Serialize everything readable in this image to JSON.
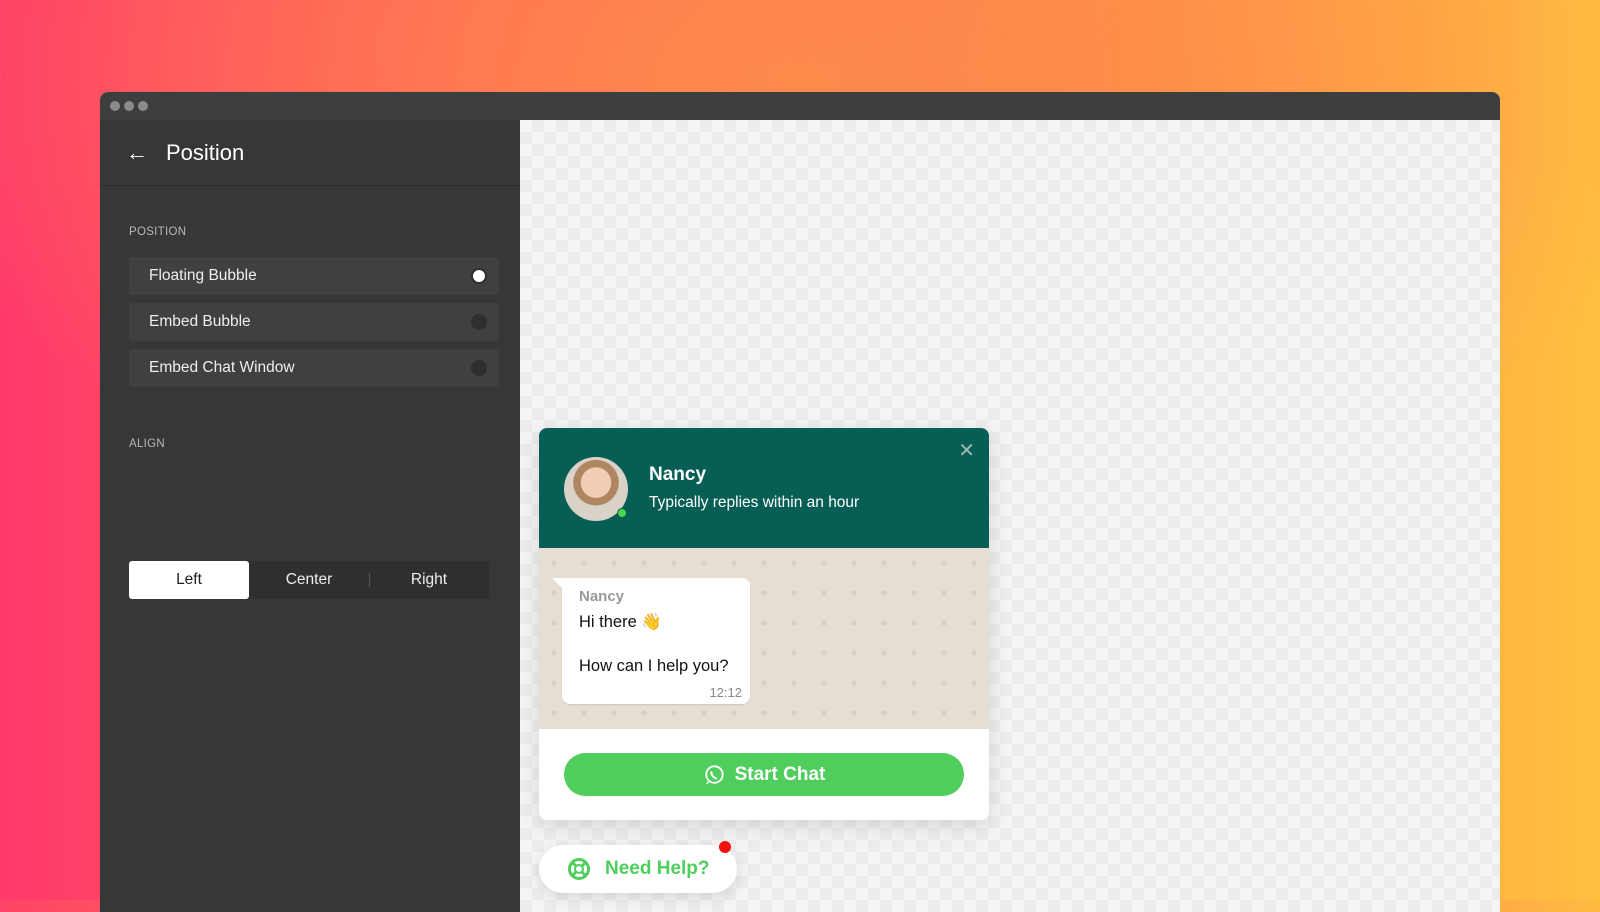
{
  "sidebar": {
    "title": "Position",
    "position_label": "POSITION",
    "options": [
      {
        "label": "Floating Bubble",
        "selected": true
      },
      {
        "label": "Embed Bubble",
        "selected": false
      },
      {
        "label": "Embed Chat Window",
        "selected": false
      }
    ],
    "align_label": "ALIGN",
    "align_options": [
      "Left",
      "Center",
      "Right"
    ],
    "align_selected": "Left"
  },
  "chat": {
    "agent_name": "Nancy",
    "status": "Typically replies within an hour",
    "message": {
      "sender": "Nancy",
      "text": "Hi there 👋\n\nHow can I help you?",
      "time": "12:12"
    },
    "start_label": "Start Chat",
    "header_color": "#075e54",
    "button_color": "#4fce5d"
  },
  "help_button": {
    "label": "Need Help?",
    "has_notification": true
  }
}
